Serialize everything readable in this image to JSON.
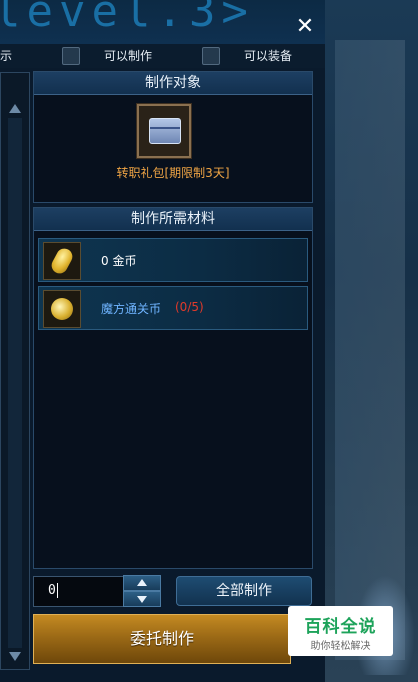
{
  "banner": {
    "text": "level.3>"
  },
  "window": {
    "close_label": "✕"
  },
  "filter": {
    "partial_text": "示",
    "craftable_label": "可以制作",
    "equippable_label": "可以装备"
  },
  "target": {
    "header": "制作对象",
    "item_icon": "gift-box-icon",
    "item_name": "转职礼包[期限制3天]"
  },
  "materials": {
    "header": "制作所需材料",
    "items": [
      {
        "icon": "gold-coin-icon",
        "text": "0  金币",
        "color": "#ffffff"
      },
      {
        "icon": "cube-pass-coin-icon",
        "text": "魔方通关币",
        "count": "(0/5)",
        "color": "#6fb4ff",
        "count_color": "#e03a2a"
      }
    ]
  },
  "quantity": {
    "value": "0"
  },
  "buttons": {
    "craft_all": "全部制作",
    "delegate": "委托制作"
  },
  "watermark": {
    "title": "百科全说",
    "subtitle": "助你轻松解决"
  }
}
